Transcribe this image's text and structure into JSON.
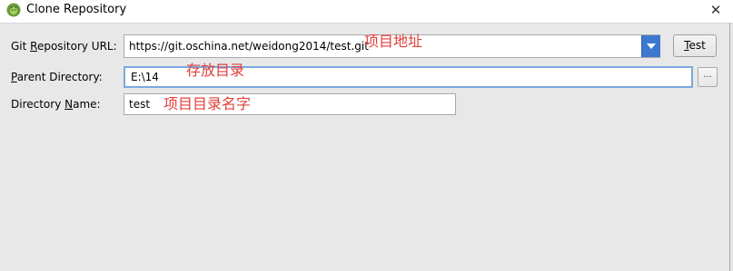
{
  "window": {
    "title": "Clone Repository",
    "close_glyph": "✕"
  },
  "form": {
    "url_label_before": "Git ",
    "url_label_mnemonic": "R",
    "url_label_after": "epository URL:",
    "url_value": "https://git.oschina.net/weidong2014/test.git",
    "test_mnemonic": "T",
    "test_rest": "est",
    "parent_label_mnemonic": "P",
    "parent_label_after": "arent Directory:",
    "parent_value": "E:\\14",
    "browse_label": "...",
    "name_label_before": "Directory ",
    "name_label_mnemonic": "N",
    "name_label_after": "ame:",
    "name_value": "test"
  },
  "annotations": {
    "url_note": "项目地址",
    "parent_note": "存放目录",
    "name_note": "项目目录名字"
  },
  "colors": {
    "annotation": "#e0403a",
    "dropdown": "#3c78d0",
    "focus_border": "#7aa8e0"
  },
  "icons": {
    "app": "android-studio-icon",
    "dropdown": "chevron-down-icon",
    "close": "close-icon"
  }
}
